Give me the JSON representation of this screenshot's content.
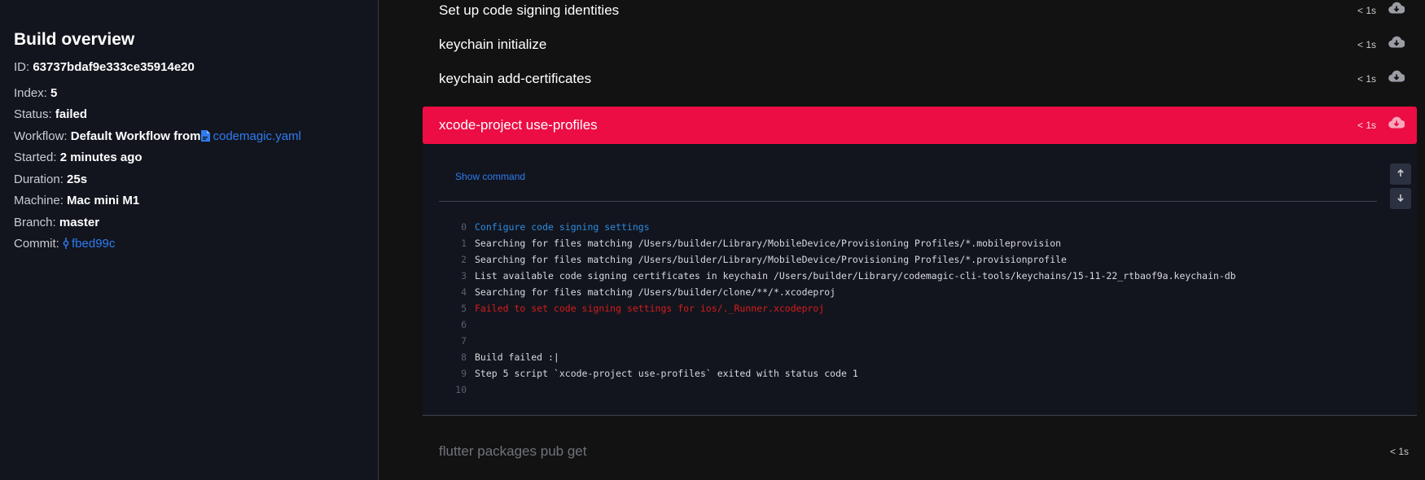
{
  "sidebar": {
    "title": "Build overview",
    "id": {
      "label": "ID:",
      "value": "63737bdaf9e333ce35914e20"
    },
    "index": {
      "label": "Index:",
      "value": "5"
    },
    "status": {
      "label": "Status:",
      "value": "failed"
    },
    "workflow": {
      "label": "Workflow:",
      "value": "Default Workflow from",
      "link": "codemagic.yaml"
    },
    "started": {
      "label": "Started:",
      "value": "2 minutes ago"
    },
    "duration": {
      "label": "Duration:",
      "value": "25s"
    },
    "machine": {
      "label": "Machine:",
      "value": "Mac mini M1"
    },
    "branch": {
      "label": "Branch:",
      "value": "master"
    },
    "commit": {
      "label": "Commit:",
      "value": "fbed99c"
    }
  },
  "steps": [
    {
      "name": "Set up code signing identities",
      "duration": "< 1s",
      "state": "success"
    },
    {
      "name": "keychain initialize",
      "duration": "< 1s",
      "state": "success"
    },
    {
      "name": "keychain add-certificates",
      "duration": "< 1s",
      "state": "success"
    },
    {
      "name": "xcode-project use-profiles",
      "duration": "< 1s",
      "state": "failed"
    },
    {
      "name": "flutter packages pub get",
      "duration": "< 1s",
      "state": "skipped"
    }
  ],
  "log": {
    "show_command_label": "Show command",
    "lines": [
      {
        "n": "0",
        "text": "Configure code signing settings",
        "color": "#2d8ce0"
      },
      {
        "n": "1",
        "text": "Searching for files matching /Users/builder/Library/MobileDevice/Provisioning Profiles/*.mobileprovision"
      },
      {
        "n": "2",
        "text": "Searching for files matching /Users/builder/Library/MobileDevice/Provisioning Profiles/*.provisionprofile"
      },
      {
        "n": "3",
        "text": "List available code signing certificates in keychain /Users/builder/Library/codemagic-cli-tools/keychains/15-11-22_rtbaof9a.keychain-db"
      },
      {
        "n": "4",
        "text": "Searching for files matching /Users/builder/clone/**/*.xcodeproj"
      },
      {
        "n": "5",
        "text": "Failed to set code signing settings for ios/._Runner.xcodeproj",
        "color": "#d81b1b"
      },
      {
        "n": "6",
        "text": ""
      },
      {
        "n": "7",
        "text": ""
      },
      {
        "n": "8",
        "text": "Build failed :|"
      },
      {
        "n": "9",
        "text": "Step 5 script `xcode-project use-profiles` exited with status code 1"
      },
      {
        "n": "10",
        "text": ""
      }
    ]
  },
  "colors": {
    "failed": "#ec0d44",
    "link": "#2f7bf0",
    "log_blue": "#2d8ce0",
    "log_red": "#d81b1b"
  },
  "icons": {
    "download": "cloud-download-icon",
    "file": "file-icon",
    "commit": "commit-icon",
    "up": "arrow-up-icon",
    "down": "arrow-down-icon"
  }
}
